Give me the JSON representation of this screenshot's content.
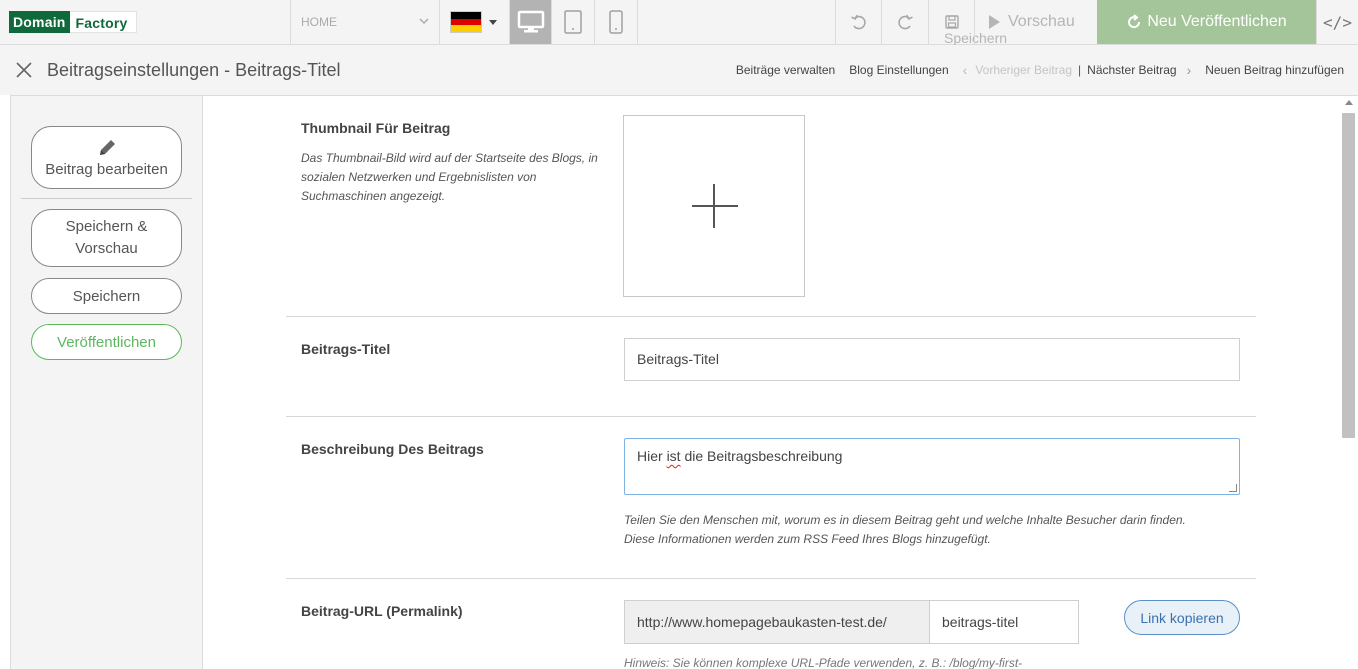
{
  "app": {
    "logo_part1": "Domain",
    "logo_part2": "Factory",
    "brand_color": "#0e6a3a"
  },
  "toolbar": {
    "page_selector": "HOME",
    "language_flag": "de-flag-icon",
    "flag_colors": [
      "#000000",
      "#dd0000",
      "#ffce00"
    ],
    "devices": [
      {
        "name": "desktop-icon",
        "active": true
      },
      {
        "name": "tablet-icon",
        "active": false
      },
      {
        "name": "mobile-icon",
        "active": false
      }
    ],
    "save_label": "Speichern",
    "preview_label": "Vorschau",
    "publish_label": "Neu Veröffentlichen",
    "publish_color": "#a4c49a",
    "code_label": "</>"
  },
  "header": {
    "title": "Beitragseinstellungen - Beitrags-Titel",
    "nav": {
      "manage_posts": "Beiträge verwalten",
      "blog_settings": "Blog Einstellungen",
      "prev_post": "Vorheriger Beitrag",
      "separator": "|",
      "next_post": "Nächster Beitrag",
      "add_post": "Neuen Beitrag hinzufügen"
    }
  },
  "sidebar": {
    "edit_post": "Beitrag bearbeiten",
    "save_preview": "Speichern & Vorschau",
    "save": "Speichern",
    "publish": "Veröffentlichen",
    "publish_color": "#5cb85c"
  },
  "form": {
    "thumbnail": {
      "label": "Thumbnail Für Beitrag",
      "help": "Das Thumbnail-Bild wird auf der Startseite des Blogs, in sozialen Netzwerken und Ergebnislisten von Suchmaschinen angezeigt."
    },
    "title": {
      "label": "Beitrags-Titel",
      "value": "Beitrags-Titel"
    },
    "description": {
      "label": "Beschreibung Des Beitrags",
      "value_part1": "Hier ",
      "value_misspelled": "ist",
      "value_part2": " die Beitragsbeschreibung",
      "help_line1": "Teilen Sie den Menschen mit, worum es in diesem Beitrag geht und welche Inhalte Besucher darin finden.",
      "help_line2": "Diese Informationen werden zum RSS Feed Ihres Blogs hinzugefügt."
    },
    "url": {
      "label": "Beitrag-URL (Permalink)",
      "prefix": "http://www.homepagebaukasten-test.de/",
      "slug": "beitrags-titel",
      "copy_button": "Link kopieren",
      "hint": "Hinweis: Sie können komplexe URL-Pfade verwenden, z. B.: /blog/my-first-"
    }
  }
}
